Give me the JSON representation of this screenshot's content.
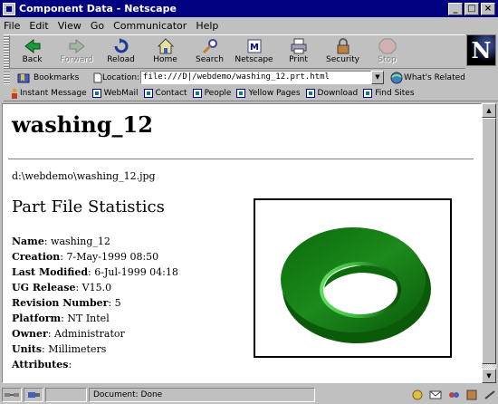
{
  "window": {
    "title": "Component Data - Netscape",
    "buttons": {
      "minimize": "_",
      "maximize": "□",
      "close": "×"
    }
  },
  "menu": [
    "File",
    "Edit",
    "View",
    "Go",
    "Communicator",
    "Help"
  ],
  "toolbar": {
    "buttons": [
      {
        "label": "Back",
        "icon": "back-arrow-icon",
        "disabled": false
      },
      {
        "label": "Forward",
        "icon": "forward-arrow-icon",
        "disabled": true
      },
      {
        "label": "Reload",
        "icon": "reload-icon",
        "disabled": false
      },
      {
        "label": "Home",
        "icon": "home-icon",
        "disabled": false
      },
      {
        "label": "Search",
        "icon": "search-icon",
        "disabled": false
      },
      {
        "label": "Netscape",
        "icon": "netscape-icon",
        "disabled": false
      },
      {
        "label": "Print",
        "icon": "print-icon",
        "disabled": false
      },
      {
        "label": "Security",
        "icon": "security-lock-icon",
        "disabled": false
      },
      {
        "label": "Stop",
        "icon": "stop-icon",
        "disabled": true
      }
    ],
    "logo": "N"
  },
  "location": {
    "bookmarks_label": "Bookmarks",
    "label": "Location:",
    "url": "file:///D|/webdemo/washing_12.prt.html",
    "related_label": "What's Related"
  },
  "personal_toolbar": [
    "Instant Message",
    "WebMail",
    "Contact",
    "People",
    "Yellow Pages",
    "Download",
    "Find Sites"
  ],
  "page": {
    "title": "washing_12",
    "image_path": "d:\\webdemo\\washing_12.jpg",
    "section_title": "Part File Statistics",
    "properties": [
      {
        "key": "Name",
        "value": "washing_12"
      },
      {
        "key": "Creation",
        "value": "7-May-1999 08:50"
      },
      {
        "key": "Last Modified",
        "value": "6-Jul-1999 04:18"
      },
      {
        "key": "UG Release",
        "value": "V15.0"
      },
      {
        "key": "Revision Number",
        "value": "5"
      },
      {
        "key": "Platform",
        "value": "NT Intel"
      },
      {
        "key": "Owner",
        "value": "Administrator"
      },
      {
        "key": "Units",
        "value": "Millimeters"
      },
      {
        "key": "Attributes",
        "value": ""
      }
    ],
    "image_color": "#1c8a1c"
  },
  "status": {
    "text": "Document: Done"
  }
}
